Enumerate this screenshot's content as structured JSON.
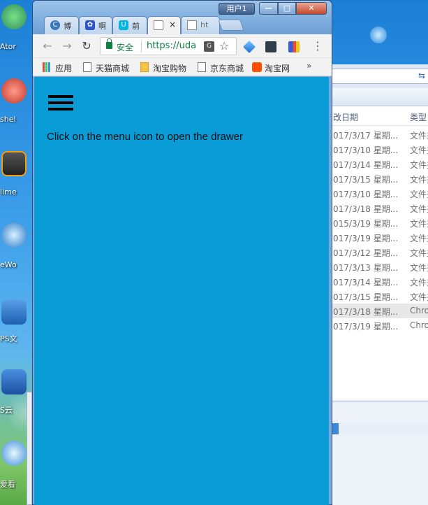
{
  "desktop": {
    "icons": [
      {
        "label": "Ator",
        "name": "atom-app-icon"
      },
      {
        "label": "shel",
        "name": "shell-app-icon"
      },
      {
        "label": "lime",
        "name": "sublime-app-icon"
      },
      {
        "label": "eWo",
        "name": "globe-app-icon"
      },
      {
        "label": "PS文",
        "name": "wps-doc-app-icon"
      },
      {
        "label": "S云",
        "name": "cloud-app-icon"
      },
      {
        "label": "爱看",
        "name": "search-app-icon"
      }
    ]
  },
  "explorer": {
    "columns": {
      "date": "改日期",
      "type": "类型"
    },
    "rows": [
      {
        "date": "017/3/17 星期...",
        "type": "文件夹"
      },
      {
        "date": "017/3/10 星期...",
        "type": "文件夹"
      },
      {
        "date": "017/3/14 星期...",
        "type": "文件夹"
      },
      {
        "date": "017/3/15 星期...",
        "type": "文件夹"
      },
      {
        "date": "017/3/10 星期...",
        "type": "文件夹"
      },
      {
        "date": "017/3/18 星期...",
        "type": "文件夹"
      },
      {
        "date": "015/3/19 星期...",
        "type": "文件夹"
      },
      {
        "date": "017/3/19 星期...",
        "type": "文件夹"
      },
      {
        "date": "017/3/12 星期...",
        "type": "文件夹"
      },
      {
        "date": "017/3/13 星期...",
        "type": "文件夹"
      },
      {
        "date": "017/3/14 星期...",
        "type": "文件夹"
      },
      {
        "date": "017/3/15 星期...",
        "type": "文件夹"
      },
      {
        "date": "017/3/18 星期...",
        "type": "Chro"
      },
      {
        "date": "017/3/19 星期...",
        "type": "Chro"
      }
    ]
  },
  "window": {
    "user_button": "用户1",
    "min_label": "—",
    "max_label": "□",
    "close_label": "✕"
  },
  "tabs": [
    {
      "label": "博",
      "icon": "blog-favicon-icon",
      "color": "#3b78c2"
    },
    {
      "label": "啊",
      "icon": "baidu-paw-favicon-icon",
      "color": "#2f56c9"
    },
    {
      "label": "前",
      "icon": "udacity-favicon-icon",
      "color": "#02b3e4"
    },
    {
      "label": "",
      "icon": "page-favicon-icon",
      "color": "#888888",
      "active": true
    },
    {
      "label": "ht",
      "icon": "page-favicon-icon",
      "color": "#888888"
    }
  ],
  "tab_close": "×",
  "omnibox": {
    "secure_label": "安全",
    "url": "https://uda",
    "translate_label": "G",
    "star": "☆"
  },
  "nav": {
    "back": "←",
    "forward": "→",
    "reload": "↻"
  },
  "menu_dots": "⋮",
  "bookmarks": [
    {
      "label": "应用",
      "icon": "apps-grid-icon"
    },
    {
      "label": "天猫商城",
      "icon": "page-icon"
    },
    {
      "label": "淘宝购物",
      "icon": "folder-icon"
    },
    {
      "label": "京东商城",
      "icon": "page-icon"
    },
    {
      "label": "淘宝网",
      "icon": "taobao-icon"
    }
  ],
  "bookmarks_more": "»",
  "page": {
    "hint": "Click on the menu icon to open the drawer",
    "background": "#0a9cd6"
  }
}
